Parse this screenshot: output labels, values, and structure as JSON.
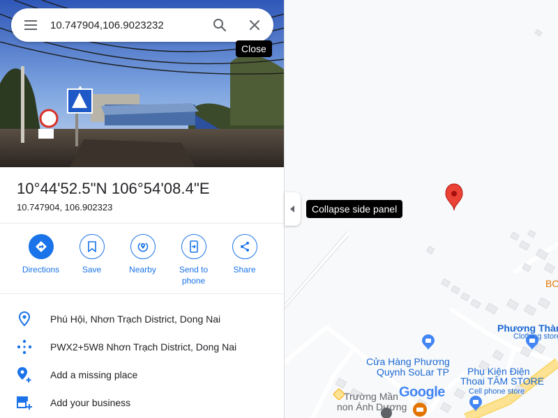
{
  "search": {
    "query": "10.747904,106.9023232",
    "close_tooltip": "Close"
  },
  "place": {
    "title": "10°44'52.5\"N 106°54'08.4\"E",
    "decimal": "10.747904, 106.902323"
  },
  "actions": [
    {
      "label": "Directions",
      "icon": "directions-icon"
    },
    {
      "label": "Save",
      "icon": "bookmark-icon"
    },
    {
      "label": "Nearby",
      "icon": "nearby-icon"
    },
    {
      "label": "Send to phone",
      "icon": "send-to-phone-icon"
    },
    {
      "label": "Share",
      "icon": "share-icon"
    }
  ],
  "info": {
    "address": "Phú Hội, Nhơn Trạch District, Dong Nai",
    "plus_code": "PWX2+5W8 Nhơn Trạch District, Dong Nai",
    "add_place": "Add a missing place",
    "add_business": "Add your business"
  },
  "panel": {
    "collapse_tooltip": "Collapse side panel"
  },
  "map": {
    "labels": {
      "bo": "BO",
      "phuong_thanh": "Phương Thành",
      "clothing": "Clothing store",
      "cua_hang_1": "Cửa Hàng Phương",
      "cua_hang_2": "Quynh SoLar TP",
      "phu_kien_1": "Phụ Kiện Điện",
      "phu_kien_2": "Thoai TÂM STORE",
      "cell_phone": "Cell phone store",
      "truong_1": "Trường Mần",
      "truong_2": "non Ánh Dương",
      "google": "Google"
    },
    "colors": {
      "pin": "#ea4335",
      "road_major": "#fde293",
      "poi_shop": "#4285f4",
      "poi_food": "#e37400",
      "orange_text": "#e37400",
      "blue_text": "#1967d2"
    }
  }
}
